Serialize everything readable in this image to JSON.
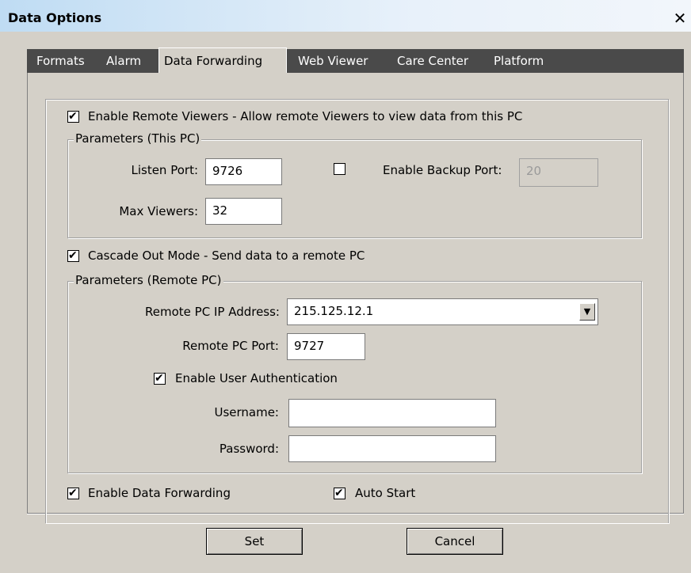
{
  "window": {
    "title": "Data Options",
    "close_glyph": "✕"
  },
  "tabs": [
    {
      "label": "Formats"
    },
    {
      "label": "Alarm"
    },
    {
      "label": "Data Forwarding"
    },
    {
      "label": "Web Viewer"
    },
    {
      "label": "Care Center"
    },
    {
      "label": "Platform"
    }
  ],
  "active_tab": "Data Forwarding",
  "remote_viewers": {
    "checkbox_label": "Enable Remote Viewers - Allow remote Viewers to view data from this PC",
    "checked": true,
    "group_label": "Parameters (This PC)",
    "listen_port_label": "Listen Port:",
    "listen_port_value": "9726",
    "backup_port_checked": false,
    "backup_port_label": "Enable Backup Port:",
    "backup_port_value": "20",
    "max_viewers_label": "Max Viewers:",
    "max_viewers_value": "32"
  },
  "cascade": {
    "checkbox_label": "Cascade Out Mode - Send data to a remote PC",
    "checked": true,
    "group_label": "Parameters (Remote PC)",
    "ip_label": "Remote PC IP Address:",
    "ip_value": "215.125.12.1",
    "port_label": "Remote PC Port:",
    "port_value": "9727",
    "auth_label": "Enable User Authentication",
    "auth_checked": true,
    "username_label": "Username:",
    "username_value": "",
    "password_label": "Password:",
    "password_value": ""
  },
  "forwarding": {
    "enable_label": "Enable Data Forwarding",
    "enable_checked": true,
    "autostart_label": "Auto Start",
    "autostart_checked": true
  },
  "buttons": {
    "set": "Set",
    "cancel": "Cancel"
  }
}
